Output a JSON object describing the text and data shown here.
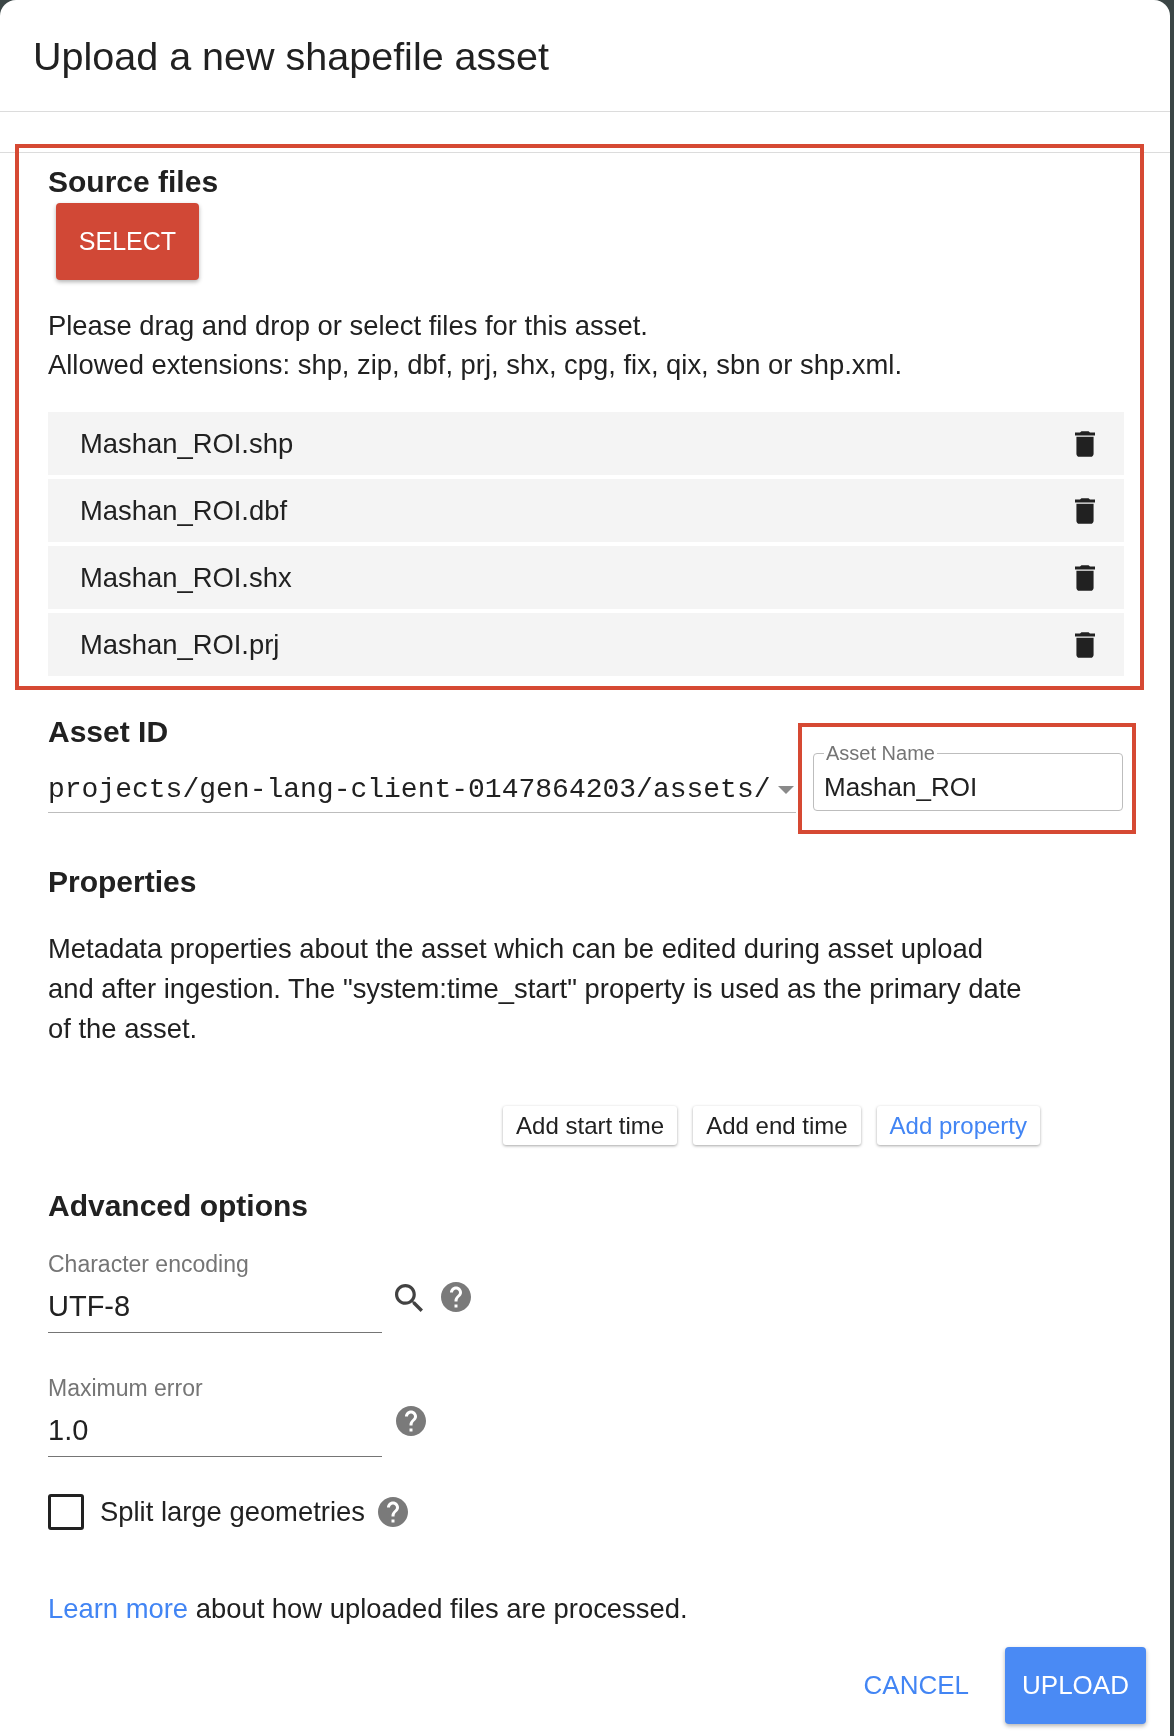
{
  "dialog": {
    "title": "Upload a new shapefile asset"
  },
  "source_files": {
    "heading": "Source files",
    "highlighted": true,
    "select_button": "SELECT",
    "instructions": [
      "Please drag and drop or select files for this asset.",
      "Allowed extensions: shp, zip, dbf, prj, shx, cpg, fix, qix, sbn or shp.xml."
    ],
    "files": [
      {
        "name": "Mashan_ROI.shp"
      },
      {
        "name": "Mashan_ROI.dbf"
      },
      {
        "name": "Mashan_ROI.shx"
      },
      {
        "name": "Mashan_ROI.prj"
      }
    ]
  },
  "asset_id": {
    "heading": "Asset ID",
    "path": "projects/gen-lang-client-0147864203/assets/",
    "name_field": {
      "label": "Asset Name",
      "value": "Mashan_ROI",
      "highlighted": true
    }
  },
  "properties": {
    "heading": "Properties",
    "description": "Metadata properties about the asset which can be edited during asset upload and after ingestion. The \"system:time_start\" property is used as the primary date of the asset.",
    "buttons": [
      {
        "label": "Add start time",
        "kind": "plain"
      },
      {
        "label": "Add end time",
        "kind": "plain"
      },
      {
        "label": "Add property",
        "kind": "accent"
      }
    ]
  },
  "advanced_options": {
    "heading": "Advanced options",
    "fields": [
      {
        "label": "Character encoding",
        "value": "UTF-8",
        "kind": "search"
      },
      {
        "label": "Maximum error",
        "value": "1.0",
        "kind": "plain"
      }
    ],
    "split_large_geometries": {
      "label": "Split large geometries",
      "checked": false
    }
  },
  "footer": {
    "note": {
      "link": "Learn more",
      "text": "about how uploaded files are processed."
    },
    "buttons": [
      {
        "label": "CANCEL",
        "kind": "text"
      },
      {
        "label": "UPLOAD",
        "kind": "filled"
      }
    ]
  }
}
